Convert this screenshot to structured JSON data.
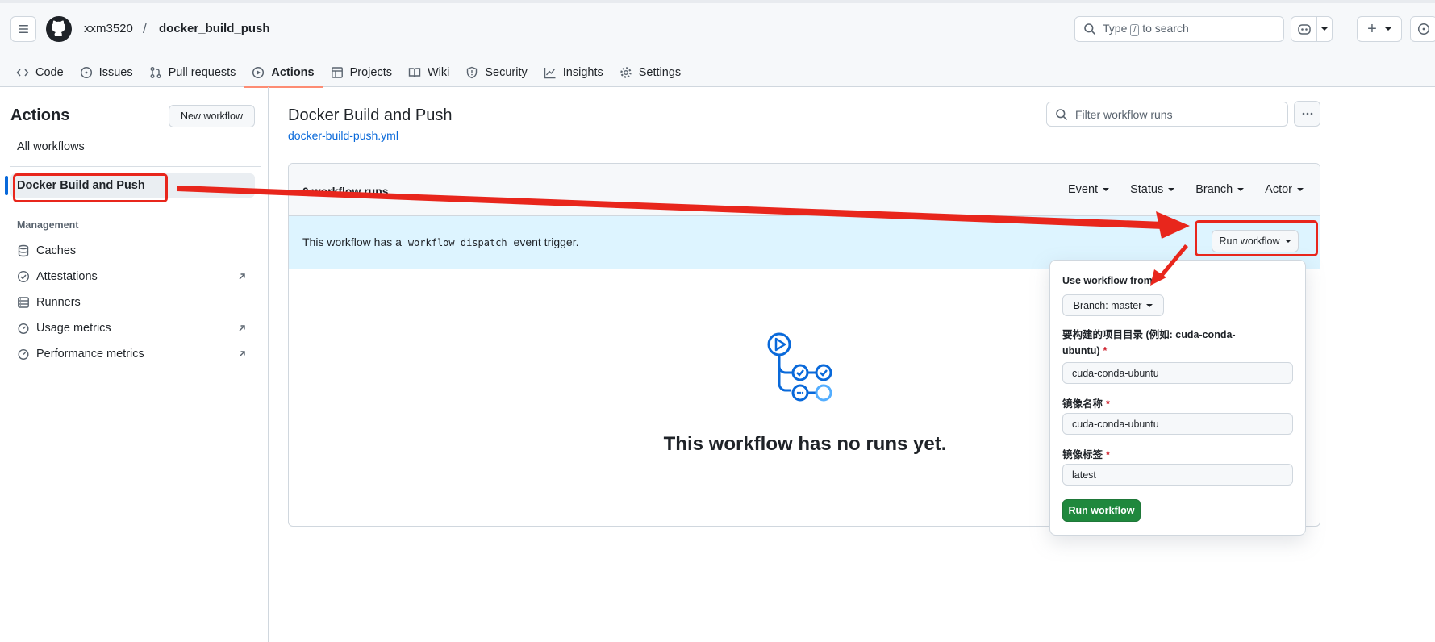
{
  "header": {
    "owner": "xxm3520",
    "separator": "/",
    "repo": "docker_build_push",
    "search_prefix": "Type",
    "search_key": "/",
    "search_suffix": "to search",
    "create_symbol": "+"
  },
  "nav": {
    "items": [
      {
        "label": "Code",
        "icon": "code-icon"
      },
      {
        "label": "Issues",
        "icon": "issue-icon"
      },
      {
        "label": "Pull requests",
        "icon": "pull-request-icon"
      },
      {
        "label": "Actions",
        "icon": "play-icon",
        "active": true
      },
      {
        "label": "Projects",
        "icon": "table-icon"
      },
      {
        "label": "Wiki",
        "icon": "book-icon"
      },
      {
        "label": "Security",
        "icon": "shield-icon"
      },
      {
        "label": "Insights",
        "icon": "graph-icon"
      },
      {
        "label": "Settings",
        "icon": "gear-icon"
      }
    ]
  },
  "sidebar": {
    "title": "Actions",
    "new_workflow": "New workflow",
    "all_workflows": "All workflows",
    "selected_workflow": "Docker Build and Push",
    "management_label": "Management",
    "links": [
      {
        "label": "Caches",
        "icon": "database-icon",
        "external": false
      },
      {
        "label": "Attestations",
        "icon": "verified-icon",
        "external": true
      },
      {
        "label": "Runners",
        "icon": "server-icon",
        "external": false
      },
      {
        "label": "Usage metrics",
        "icon": "stopwatch-icon",
        "external": true
      },
      {
        "label": "Performance metrics",
        "icon": "stopwatch-icon",
        "external": true
      }
    ]
  },
  "main": {
    "title": "Docker Build and Push",
    "file": "docker-build-push.yml",
    "filter_placeholder": "Filter workflow runs",
    "runs_count": "0 workflow runs",
    "filters": [
      "Event",
      "Status",
      "Branch",
      "Actor"
    ],
    "dispatch_prefix": "This workflow has a",
    "dispatch_code": "workflow_dispatch",
    "dispatch_suffix": "event trigger.",
    "run_workflow": "Run workflow",
    "empty_message": "This workflow has no runs yet."
  },
  "popover": {
    "use_from": "Use workflow from",
    "branch": "Branch: master",
    "field1_label_line1": "要构建的项目目录 (例如: cuda-conda-",
    "field1_label_line2": "ubuntu)",
    "field1_value": "cuda-conda-ubuntu",
    "field2_label": "镜像名称",
    "field2_value": "cuda-conda-ubuntu",
    "field3_label": "镜像标签",
    "field3_value": "latest",
    "required_mark": "*",
    "submit": "Run workflow"
  },
  "colors": {
    "accent": "#0969da",
    "active_tab_underline": "#fd8c73",
    "dispatch_bg": "#ddf4ff",
    "primary_button": "#1f883d",
    "annotation_red": "#e8261c"
  }
}
